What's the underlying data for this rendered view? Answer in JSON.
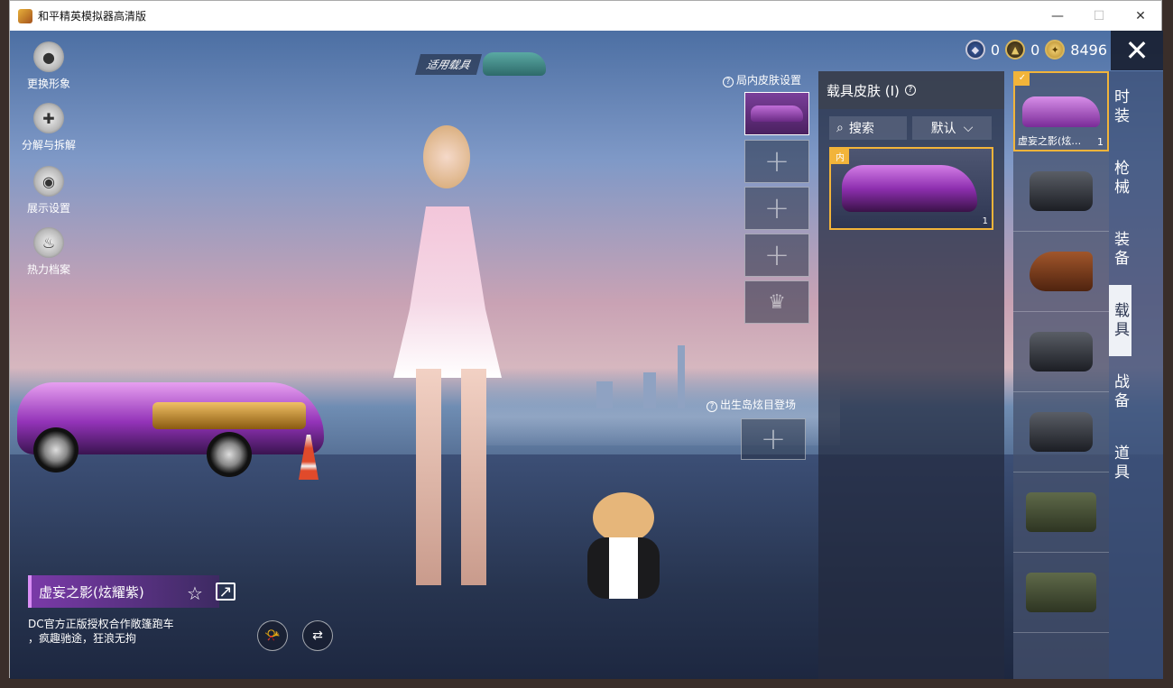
{
  "window": {
    "title": "和平精英模拟器高清版",
    "minimize": "—",
    "maximize": "☐",
    "close": "✕"
  },
  "left_menu": [
    {
      "label": "更换形象",
      "icon": "avatar-icon"
    },
    {
      "label": "分解与拆解",
      "icon": "puzzle-icon"
    },
    {
      "label": "展示设置",
      "icon": "eye-icon"
    },
    {
      "label": "热力档案",
      "icon": "flame-icon"
    }
  ],
  "vehicle_tag": "适用载具",
  "currency": {
    "silver": "0",
    "medal": "0",
    "coin": "8496"
  },
  "close_button": "✕",
  "in_game_skin_label": "局内皮肤设置",
  "slot_plus": "+",
  "crown_slot": "♛",
  "birth_island_label": "出生岛炫目登场",
  "skin_panel": {
    "title": "载具皮肤 (I)",
    "search": "搜索",
    "sort": "默认",
    "card_tag": "内",
    "card_count": "1"
  },
  "vehicle_list": [
    {
      "label": "虚妄之影(炫…",
      "count": "1",
      "type": "car-purple",
      "active": true
    },
    {
      "label": "",
      "count": "",
      "type": "motorcycle"
    },
    {
      "label": "",
      "count": "",
      "type": "horse"
    },
    {
      "label": "",
      "count": "",
      "type": "buggy"
    },
    {
      "label": "",
      "count": "",
      "type": "motorcycle"
    },
    {
      "label": "",
      "count": "",
      "type": "jeep"
    },
    {
      "label": "",
      "count": "",
      "type": "jeep"
    }
  ],
  "categories": [
    "时装",
    "枪械",
    "装备",
    "载具",
    "战备",
    "道具"
  ],
  "active_category": "载具",
  "item_name": "虚妄之影(炫耀紫)",
  "item_desc_1": "DC官方正版授权合作敞篷跑车",
  "item_desc_2": "，疯趣驰途，狂浪无拘",
  "colors": {
    "accent_gold": "#f2b43a",
    "purple": "#9333b8"
  }
}
